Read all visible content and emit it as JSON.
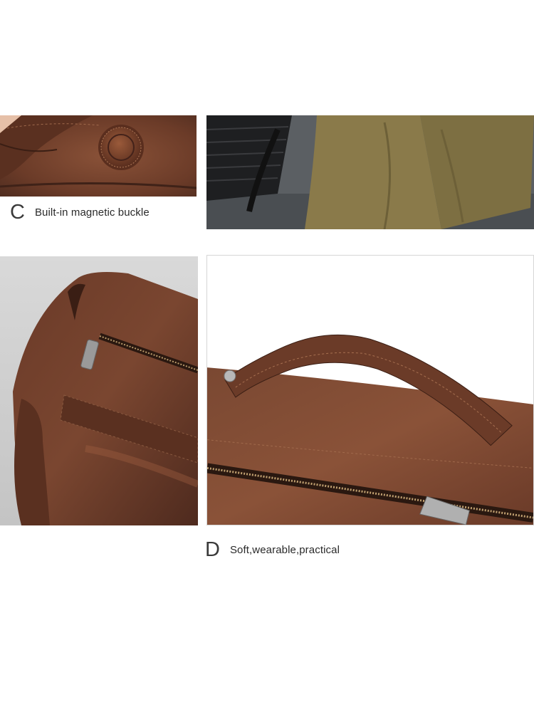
{
  "captions": [
    {
      "letter": "C",
      "text": "Built-in magnetic buckle"
    },
    {
      "letter": "D",
      "text": "Soft,wearable,practical"
    }
  ],
  "photos": [
    {
      "subject": "magnetic-buckle-closeup"
    },
    {
      "subject": "person-standing-by-chair"
    },
    {
      "subject": "bag-side-zipper-pocket"
    },
    {
      "subject": "bag-top-handle-zipper"
    }
  ],
  "colors": {
    "leather_dark": "#4a2a1e",
    "leather_mid": "#6b3b28",
    "leather_light": "#8a5238",
    "trousers": "#8a7a4a",
    "carpet": "#5b5f63",
    "background": "#ffffff"
  }
}
